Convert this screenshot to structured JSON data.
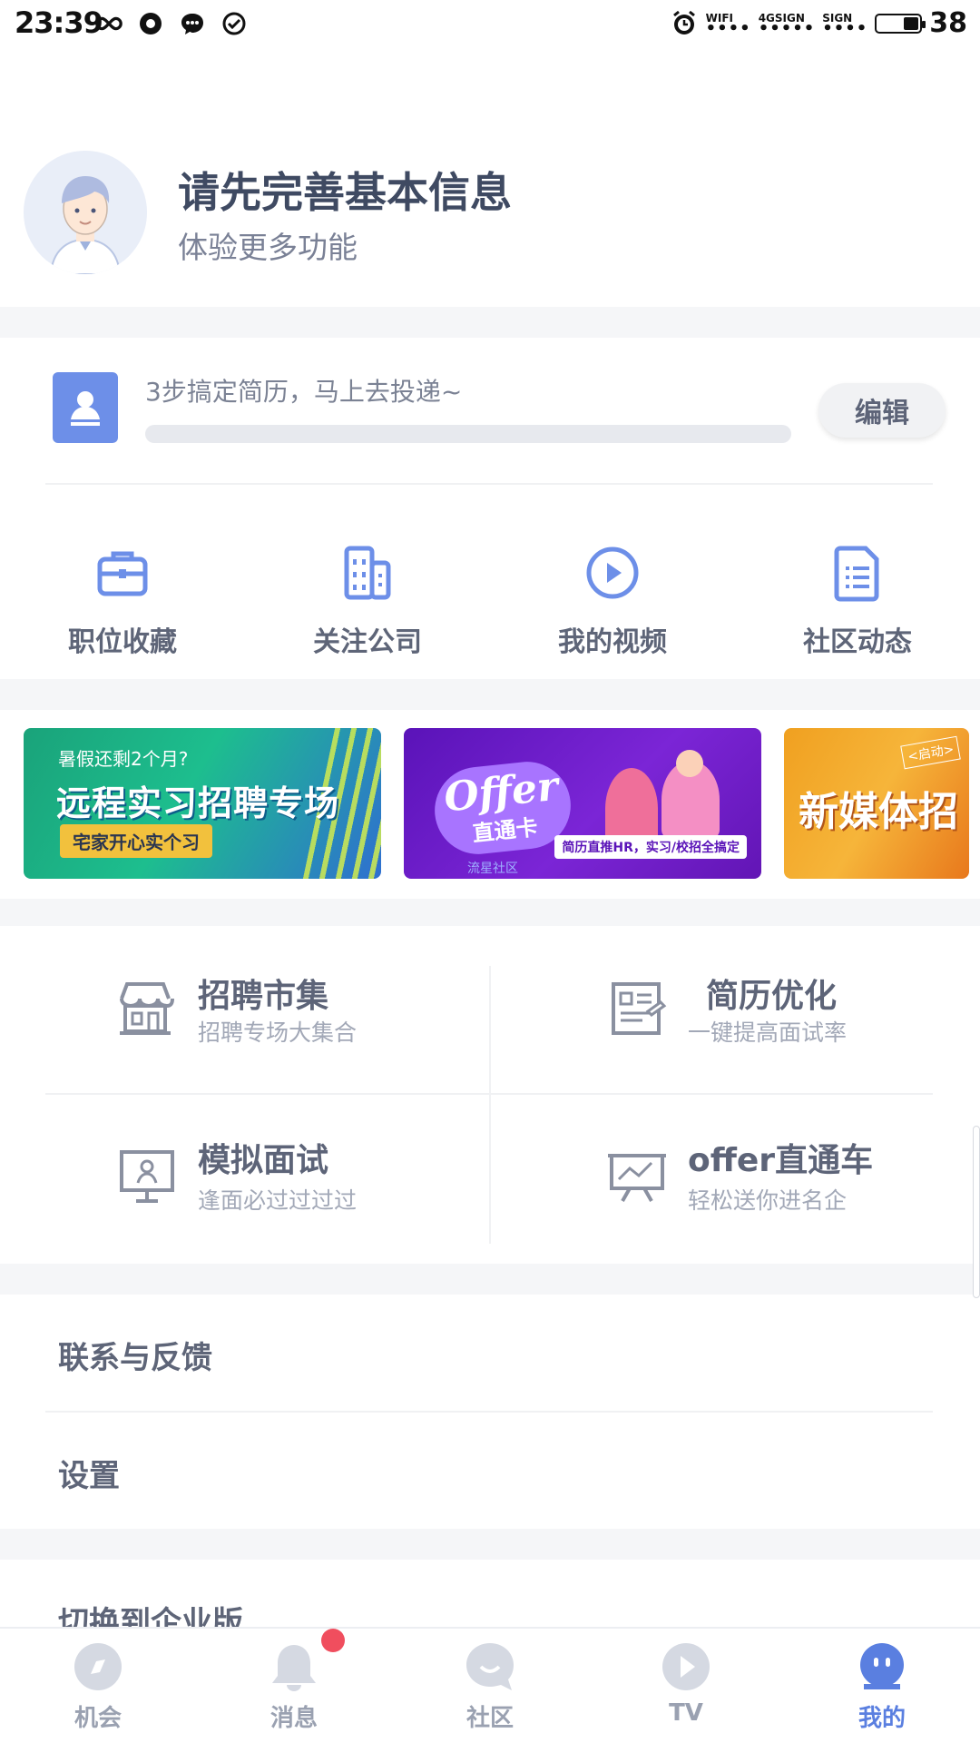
{
  "status_bar": {
    "time": "23:39",
    "wifi_label": "WIFI",
    "signal_1_label": "4GSIGN",
    "signal_2_label": "SIGN",
    "battery": "38",
    "battery_level": 0.38
  },
  "profile": {
    "title": "请先完善基本信息",
    "subtitle": "体验更多功能"
  },
  "resume": {
    "prompt": "3步搞定简历，马上去投递~",
    "progress_fraction": 0,
    "edit_label": "编辑"
  },
  "quick_links": [
    {
      "label": "职位收藏",
      "icon": "briefcase-icon"
    },
    {
      "label": "关注公司",
      "icon": "building-icon"
    },
    {
      "label": "我的视频",
      "icon": "play-circle-icon"
    },
    {
      "label": "社区动态",
      "icon": "document-list-icon"
    }
  ],
  "banners": {
    "b1": {
      "top_text": "暑假还剩2个月?",
      "main_text": "远程实习招聘专场",
      "tag": "宅家开心实个习"
    },
    "b2": {
      "offer": "Offer",
      "card": "直通卡",
      "note": "简历直推HR，实习/校招全搞定",
      "footer": "流星社区"
    },
    "b3": {
      "main_text": "新媒体招",
      "tag": "<启动>"
    }
  },
  "services": [
    {
      "title": "招聘市集",
      "subtitle": "招聘专场大集合",
      "icon": "storefront-icon"
    },
    {
      "title": "简历优化",
      "subtitle": "一键提高面试率",
      "icon": "resume-doc-icon"
    },
    {
      "title": "模拟面试",
      "subtitle": "逢面必过过过过",
      "icon": "interview-monitor-icon"
    },
    {
      "title": "offer直通车",
      "subtitle": "轻松送你进名企",
      "icon": "chart-board-icon"
    }
  ],
  "menu": [
    {
      "label": "联系与反馈"
    },
    {
      "label": "设置"
    },
    {
      "label": "切换到企业版"
    }
  ],
  "tabbar": [
    {
      "label": "机会",
      "icon": "compass-icon"
    },
    {
      "label": "消息",
      "icon": "bell-icon"
    },
    {
      "label": "社区",
      "icon": "chat-smile-icon"
    },
    {
      "label": "TV",
      "icon": "play-icon"
    },
    {
      "label": "我的",
      "icon": "profile-face-icon",
      "active": true
    }
  ],
  "colors": {
    "accent": "#5a7fe0",
    "icon_blue": "#6d8fe8",
    "badge_red": "#f04e5e",
    "text_dark": "#3f4a62",
    "text_gray": "#7a8196"
  }
}
